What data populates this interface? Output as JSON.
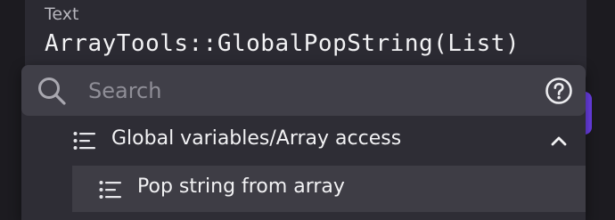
{
  "text_field": {
    "label": "Text",
    "value": "ArrayTools::GlobalPopString(List)"
  },
  "autocomplete": {
    "search": {
      "placeholder": "Search",
      "value": "",
      "icon": "search-icon"
    },
    "help_icon": "help-icon",
    "groups": [
      {
        "label": "Global variables/Array access",
        "icon": "list-icon",
        "expanded": true,
        "items": [
          {
            "label": "Pop string from array",
            "icon": "list-icon",
            "highlighted": true
          }
        ]
      }
    ]
  },
  "colors": {
    "background": "#1c1b20",
    "panel": "#2e2d35",
    "search_bar": "#403f48",
    "highlight": "#3e3d45",
    "accent": "#6b3fe8",
    "text": "#f2f2f4",
    "muted_text": "#8f8e97"
  }
}
